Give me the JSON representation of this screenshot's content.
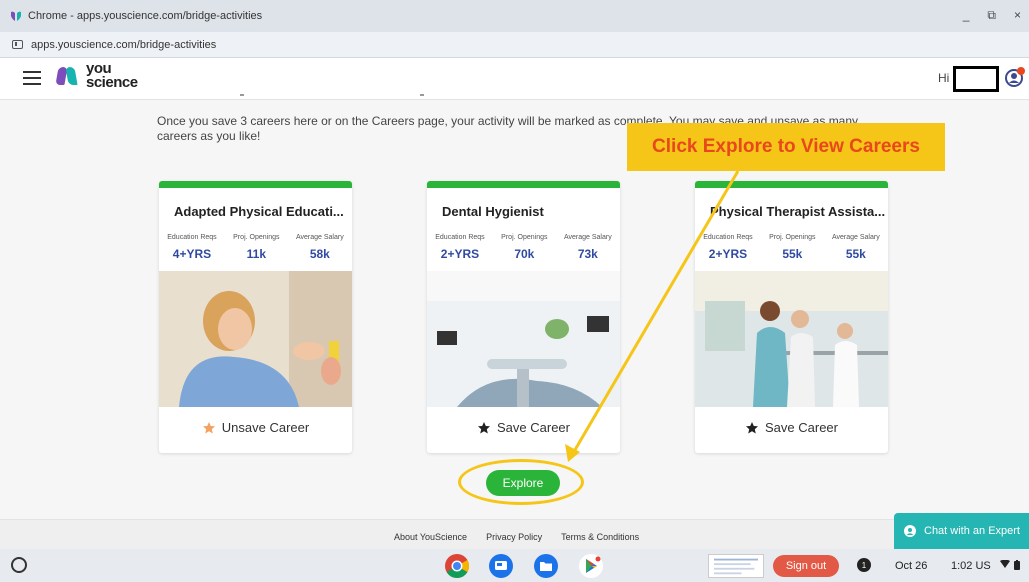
{
  "window": {
    "title": "Chrome - apps.youscience.com/bridge-activities",
    "controls": [
      "_",
      "⧉",
      "×"
    ]
  },
  "address_bar": {
    "url": "apps.youscience.com/bridge-activities"
  },
  "header": {
    "logo_line1": "you",
    "logo_line2": "science",
    "greeting": "Hi"
  },
  "intro": "Once you save 3 careers here or on the Careers page, your activity will be marked as complete. You may save and unsave as many careers as you like!",
  "stat_labels": {
    "education": "Education Reqs",
    "openings": "Proj. Openings",
    "salary": "Average Salary"
  },
  "cards": [
    {
      "title": "Adapted Physical Educati...",
      "education": "4+YRS",
      "openings": "11k",
      "salary": "58k",
      "save_label": "Unsave Career",
      "saved": true
    },
    {
      "title": "Dental Hygienist",
      "education": "2+YRS",
      "openings": "70k",
      "salary": "73k",
      "save_label": "Save Career",
      "saved": false
    },
    {
      "title": "Physical Therapist Assista...",
      "education": "2+YRS",
      "openings": "55k",
      "salary": "55k",
      "save_label": "Save Career",
      "saved": false
    }
  ],
  "explore_button": "Explore",
  "callout": "Click Explore to View Careers",
  "footer": {
    "links": [
      "About YouScience",
      "Privacy Policy",
      "Terms & Conditions"
    ]
  },
  "chat": "Chat with an Expert",
  "taskbar": {
    "sign_out": "Sign out",
    "notifications": "1",
    "date": "Oct 26",
    "time": "1:02",
    "locale": "US"
  },
  "colors": {
    "accent_green": "#2ab53a",
    "stat_blue": "#2f4aa0",
    "callout_yellow": "#f5c518",
    "callout_text": "#e8481c",
    "chat_teal": "#25b5b2",
    "signout_red": "#e25945",
    "saved_star": "#f4a261"
  }
}
